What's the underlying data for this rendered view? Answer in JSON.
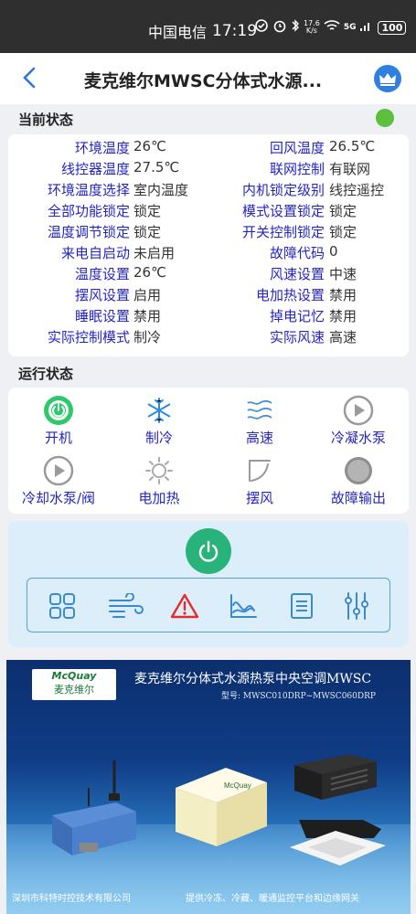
{
  "status_bar": {
    "carrier": "中国电信",
    "time": "17:19",
    "speed_value": "17.6",
    "speed_unit": "K/s",
    "network": "5G",
    "battery": "100"
  },
  "header": {
    "title": "麦克维尔MWSC分体式水源...",
    "back_icon": "chevron-left-icon",
    "crown_icon": "crown-icon"
  },
  "current_status": {
    "title": "当前状态",
    "online_color": "#5cc03c",
    "rows": [
      {
        "label1": "环境温度",
        "value1": "26℃",
        "label2": "回风温度",
        "value2": "26.5℃"
      },
      {
        "label1": "线控器温度",
        "value1": "27.5℃",
        "label2": "联网控制",
        "value2": "有联网"
      },
      {
        "label1": "环境温度选择",
        "value1": "室内温度",
        "label2": "内机锁定级别",
        "value2": "线控遥控"
      },
      {
        "label1": "全部功能锁定",
        "value1": "锁定",
        "label2": "模式设置锁定",
        "value2": "锁定"
      },
      {
        "label1": "温度调节锁定",
        "value1": "锁定",
        "label2": "开关控制锁定",
        "value2": "锁定"
      },
      {
        "label1": "来电自启动",
        "value1": "未启用",
        "label2": "故障代码",
        "value2": "0"
      },
      {
        "label1": "温度设置",
        "value1": "26℃",
        "label2": "风速设置",
        "value2": "中速"
      },
      {
        "label1": "摆风设置",
        "value1": "启用",
        "label2": "电加热设置",
        "value2": "禁用"
      },
      {
        "label1": "睡眠设置",
        "value1": "禁用",
        "label2": "掉电记忆",
        "value2": "禁用"
      },
      {
        "label1": "实际控制模式",
        "value1": "制冷",
        "label2": "实际风速",
        "value2": "高速"
      }
    ]
  },
  "run_status": {
    "title": "运行状态",
    "items": [
      {
        "label": "开机",
        "icon": "power-on-icon"
      },
      {
        "label": "制冷",
        "icon": "snowflake-icon"
      },
      {
        "label": "高速",
        "icon": "wind-speed-icon"
      },
      {
        "label": "冷凝水泵",
        "icon": "play-circle-icon"
      },
      {
        "label": "冷却水泵/阀",
        "icon": "play-circle-icon"
      },
      {
        "label": "电加热",
        "icon": "sun-icon"
      },
      {
        "label": "摆风",
        "icon": "swing-icon"
      },
      {
        "label": "故障输出",
        "icon": "fault-dot-icon"
      }
    ]
  },
  "control": {
    "power_icon": "power-icon",
    "tools": [
      "grid-icon",
      "wind-icon",
      "alert-icon",
      "chart-icon",
      "list-icon",
      "sliders-icon"
    ]
  },
  "banner": {
    "logo_en": "McQuay",
    "logo_zh": "麦克维尔",
    "title": "麦克维尔分体式水源热泵中央空调MWSC",
    "model": "型号: MWSC010DRP~MWSC060DRP",
    "footer_left": "深圳市科特时控技术有限公司",
    "footer_right": "提供冷冻、冷藏、暖通监控平台和边缘网关"
  }
}
